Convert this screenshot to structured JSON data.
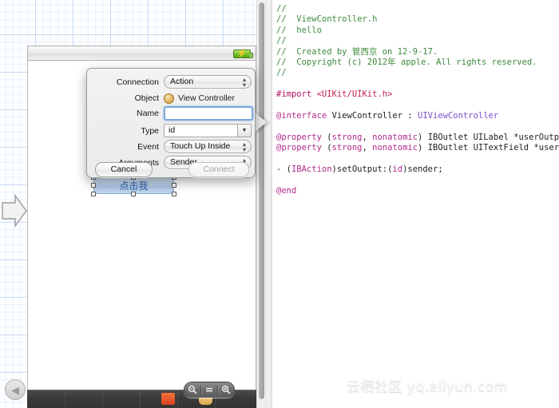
{
  "canvas": {
    "device_button": {
      "label": "点击我"
    },
    "status_bar": {
      "battery_icon": "battery-charging-icon",
      "bolt_glyph": "⚡"
    },
    "entry_arrow_icon": "entry-point-arrow-icon",
    "back_button": {
      "icon": "chevron-left-icon",
      "glyph": "◀"
    },
    "zoom_controls": {
      "zoom_out": {
        "icon": "zoom-out-icon",
        "glyph": "⊖"
      },
      "zoom_fit": {
        "icon": "zoom-actual-size-icon",
        "glyph": "="
      },
      "zoom_in": {
        "icon": "zoom-in-icon",
        "glyph": "⊕"
      }
    },
    "dock": {
      "icon_1": "tab-bar-item-icon",
      "icon_2": "tab-bar-item-icon"
    }
  },
  "dialog": {
    "title": "Connection popover",
    "pointer_icon": "popover-pointer",
    "rows": [
      {
        "label": "Connection",
        "value": "Action",
        "control": "popup"
      },
      {
        "label": "Object",
        "value": "View Controller",
        "control": "static",
        "icon": "view-controller-icon"
      },
      {
        "label": "Name",
        "value": "",
        "control": "text",
        "placeholder": ""
      },
      {
        "label": "Type",
        "value": "id",
        "control": "combo"
      },
      {
        "label": "Event",
        "value": "Touch Up Inside",
        "control": "popup"
      },
      {
        "label": "Arguments",
        "value": "Sender",
        "control": "popup"
      }
    ],
    "stepper_glyph": "⌃⌄",
    "combo_arrow_glyph": "▼",
    "cancel_label": "Cancel",
    "connect_label": "Connect"
  },
  "editor": {
    "lines": [
      [
        {
          "t": "//",
          "c": "cm"
        }
      ],
      [
        {
          "t": "//  ViewController.h",
          "c": "cm"
        }
      ],
      [
        {
          "t": "//  hello",
          "c": "cm"
        }
      ],
      [
        {
          "t": "//",
          "c": "cm"
        }
      ],
      [
        {
          "t": "//  Created by 管西京 on 12-9-17.",
          "c": "cm"
        }
      ],
      [
        {
          "t": "//  Copyright (c) 2012年 apple. All rights reserved.",
          "c": "cm"
        }
      ],
      [
        {
          "t": "//",
          "c": "cm"
        }
      ],
      [
        {
          "t": "",
          "c": "plain"
        }
      ],
      [
        {
          "t": "#import ",
          "c": "pre"
        },
        {
          "t": "<UIKit/UIKit.h>",
          "c": "str"
        }
      ],
      [
        {
          "t": "",
          "c": "plain"
        }
      ],
      [
        {
          "t": "@interface ",
          "c": "kw"
        },
        {
          "t": "ViewController",
          "c": "plain"
        },
        {
          "t": " : ",
          "c": "plain"
        },
        {
          "t": "UIViewController",
          "c": "type"
        }
      ],
      [
        {
          "t": "",
          "c": "plain"
        }
      ],
      [
        {
          "t": "@property ",
          "c": "kw"
        },
        {
          "t": "(",
          "c": "plain"
        },
        {
          "t": "strong",
          "c": "kw"
        },
        {
          "t": ", ",
          "c": "plain"
        },
        {
          "t": "nonatomic",
          "c": "kw"
        },
        {
          "t": ") IBOutlet UILabel *userOutput;",
          "c": "plain"
        }
      ],
      [
        {
          "t": "@property ",
          "c": "kw"
        },
        {
          "t": "(",
          "c": "plain"
        },
        {
          "t": "strong",
          "c": "kw"
        },
        {
          "t": ", ",
          "c": "plain"
        },
        {
          "t": "nonatomic",
          "c": "kw"
        },
        {
          "t": ") IBOutlet UITextField *userInput;",
          "c": "plain"
        }
      ],
      [
        {
          "t": "",
          "c": "plain"
        }
      ],
      [
        {
          "t": "- (",
          "c": "plain"
        },
        {
          "t": "IBAction",
          "c": "kw"
        },
        {
          "t": ")setOutput:(",
          "c": "plain"
        },
        {
          "t": "id",
          "c": "kw"
        },
        {
          "t": ")sender;",
          "c": "plain"
        }
      ],
      [
        {
          "t": "",
          "c": "plain"
        }
      ],
      [
        {
          "t": "@end",
          "c": "kw"
        }
      ]
    ]
  },
  "watermark": {
    "text": "云栖社区 yq.aliyun.com"
  }
}
